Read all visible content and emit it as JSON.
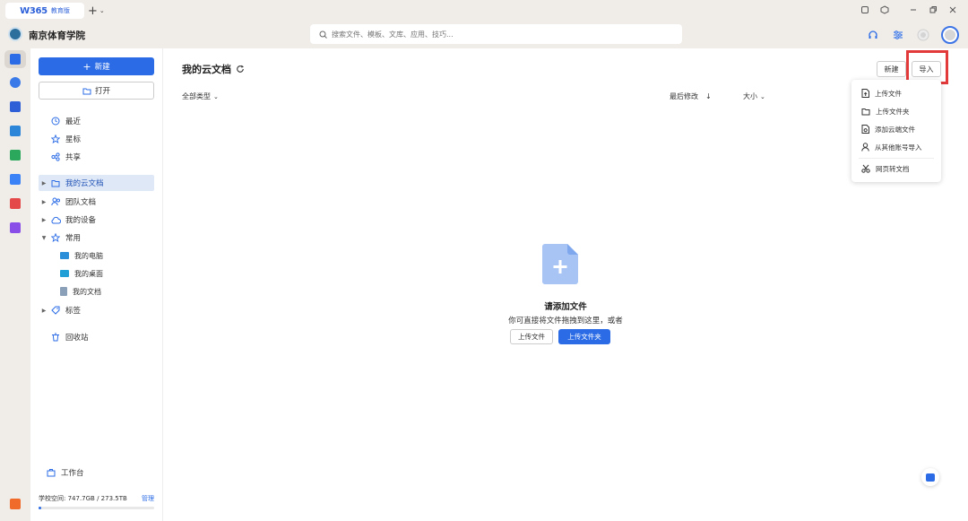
{
  "app": {
    "logo_text": "W365",
    "edition": "教育版",
    "new_tab": "+"
  },
  "header": {
    "school_name": "南京体育学院",
    "search_placeholder": "搜索文件、模板、文库、应用、技巧..."
  },
  "sidebar": {
    "new_label": "新建",
    "open_label": "打开",
    "quick": [
      {
        "label": "最近",
        "icon": "clock-icon"
      },
      {
        "label": "星标",
        "icon": "star-icon"
      },
      {
        "label": "共享",
        "icon": "share-icon"
      }
    ],
    "tree": [
      {
        "label": "我的云文档",
        "icon": "folder-icon",
        "active": true
      },
      {
        "label": "团队文档",
        "icon": "team-icon"
      },
      {
        "label": "我的设备",
        "icon": "cloud-device-icon"
      },
      {
        "label": "常用",
        "icon": "pin-icon",
        "expanded": true
      }
    ],
    "common_items": [
      "我的电脑",
      "我的桌面",
      "我的文档"
    ],
    "tags_label": "标签",
    "recycle_label": "回收站",
    "workbench_label": "工作台",
    "storage_text": "学校空间: 747.7GB / 273.5TB",
    "storage_manage": "管理",
    "storage_used_fraction": 0.003
  },
  "main": {
    "title": "我的云文档",
    "new_label": "新建",
    "import_label": "导入",
    "col_type": "全部类型",
    "col_modified": "最后修改",
    "col_size": "大小",
    "empty_title": "请添加文件",
    "empty_sub": "你可直接将文件拖拽到这里，或者",
    "upload_file": "上传文件",
    "upload_folder": "上传文件夹"
  },
  "import_menu": {
    "items": [
      "上传文件",
      "上传文件夹",
      "添加云端文件",
      "从其他账号导入"
    ],
    "extra": "网页转文档"
  },
  "colors": {
    "accent": "#2b6ce6",
    "highlight": "#e23a3a"
  }
}
